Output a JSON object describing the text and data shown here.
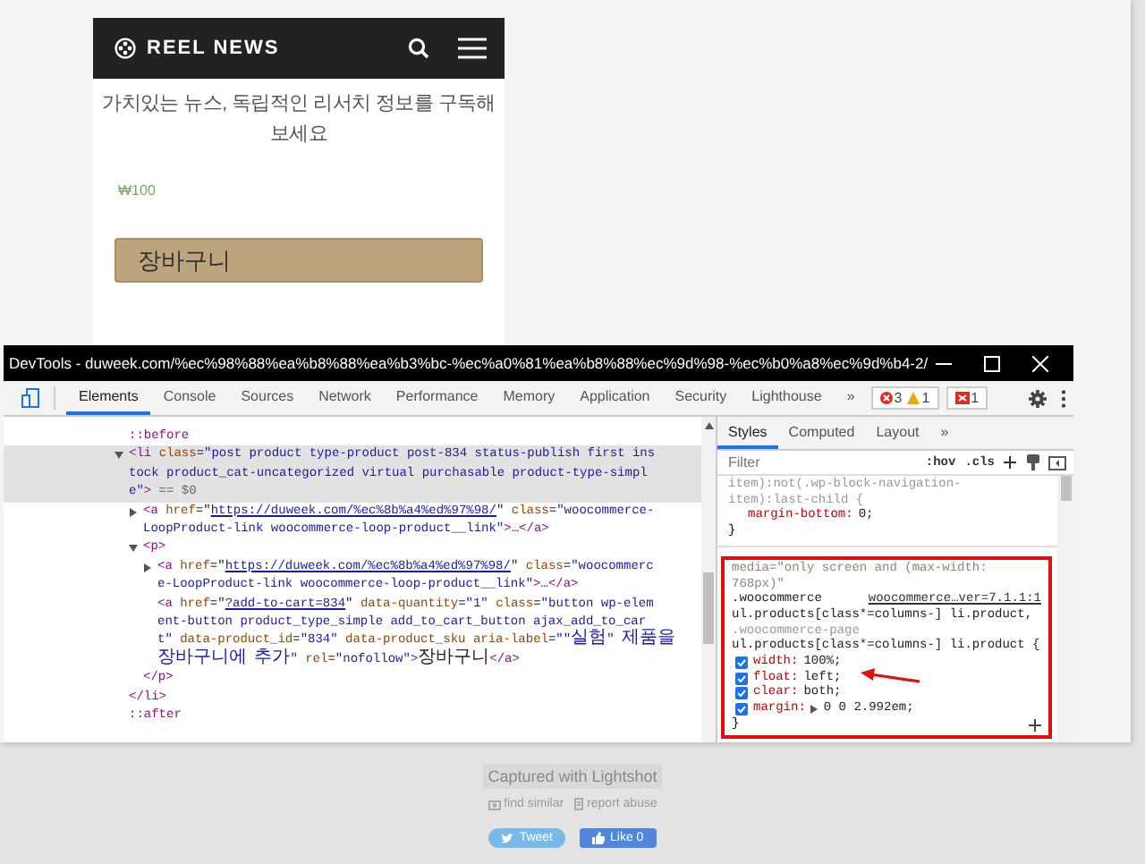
{
  "mobile_page": {
    "logo": "REEL NEWS",
    "description": "가치있는 뉴스, 독립적인 리서치 정보를 구독해 보세요",
    "price": "₩100",
    "cart_button": "장바구니"
  },
  "devtools": {
    "title": "DevTools - duweek.com/%ec%98%88%ea%b8%88%ea%b3%bc-%ec%a0%81%ea%b8%88%ec%9d%98-%ec%b0%a8%ec%9d%b4-2/",
    "tabs": [
      {
        "label": "Elements",
        "selected": true
      },
      {
        "label": "Console",
        "selected": false
      },
      {
        "label": "Sources",
        "selected": false
      },
      {
        "label": "Network",
        "selected": false
      },
      {
        "label": "Performance",
        "selected": false
      },
      {
        "label": "Memory",
        "selected": false
      },
      {
        "label": "Application",
        "selected": false
      },
      {
        "label": "Security",
        "selected": false
      },
      {
        "label": "Lighthouse",
        "selected": false
      }
    ],
    "more_tabs": "»",
    "issue_counts": {
      "errors": "3",
      "warnings": "1",
      "issues": "1"
    },
    "dom_nodes": [
      {
        "kind": "pseudo",
        "text": "::before",
        "selected": false
      },
      {
        "kind": "element",
        "selected": true,
        "expanded": true,
        "lines": [
          [
            {
              "kind": "tag",
              "text": "<li "
            },
            {
              "kind": "attr",
              "text": "class"
            },
            {
              "kind": "text",
              "text": "="
            },
            {
              "kind": "value",
              "text": "\"post product type-product post-834 status-publish first ins"
            }
          ],
          [
            {
              "kind": "value",
              "text": "tock product_cat-uncategorized virtual purchasable product-type-simpl"
            }
          ],
          [
            {
              "kind": "value",
              "text": "e\""
            },
            {
              "kind": "tag",
              "text": ">"
            },
            {
              "kind": "hint",
              "text": " == $0"
            }
          ]
        ],
        "closing": [
          {
            "kind": "tag",
            "text": "</li>"
          }
        ],
        "children": [
          {
            "kind": "element",
            "selected": false,
            "expanded": false,
            "lines": [
              [
                {
                  "kind": "tag",
                  "text": "<a "
                },
                {
                  "kind": "attr",
                  "text": "href"
                },
                {
                  "kind": "text",
                  "text": "=\""
                },
                {
                  "kind": "link",
                  "text": "https://duweek.com/%ec%8b%a4%ed%97%98/"
                },
                {
                  "kind": "text",
                  "text": "\" "
                },
                {
                  "kind": "attr",
                  "text": "class"
                },
                {
                  "kind": "text",
                  "text": "="
                },
                {
                  "kind": "value",
                  "text": "\"woocommerce-"
                }
              ],
              [
                {
                  "kind": "value",
                  "text": "LoopProduct-link woocommerce-loop-product__link\""
                },
                {
                  "kind": "tag",
                  "text": ">"
                },
                {
                  "kind": "text",
                  "text": "…"
                },
                {
                  "kind": "tag",
                  "text": "</a>"
                }
              ]
            ]
          },
          {
            "kind": "element",
            "selected": false,
            "expanded": true,
            "lines": [
              [
                {
                  "kind": "tag",
                  "text": "<p>"
                }
              ]
            ],
            "closing": [
              {
                "kind": "tag",
                "text": "</p>"
              }
            ],
            "children": [
              {
                "kind": "element",
                "selected": false,
                "expanded": false,
                "lines": [
                  [
                    {
                      "kind": "tag",
                      "text": "<a "
                    },
                    {
                      "kind": "attr",
                      "text": "href"
                    },
                    {
                      "kind": "text",
                      "text": "=\""
                    },
                    {
                      "kind": "link",
                      "text": "https://duweek.com/%ec%8b%a4%ed%97%98/"
                    },
                    {
                      "kind": "text",
                      "text": "\" "
                    },
                    {
                      "kind": "attr",
                      "text": "class"
                    },
                    {
                      "kind": "text",
                      "text": "="
                    },
                    {
                      "kind": "value",
                      "text": "\"woocommerc"
                    }
                  ],
                  [
                    {
                      "kind": "value",
                      "text": "e-LoopProduct-link woocommerce-loop-product__link\""
                    },
                    {
                      "kind": "tag",
                      "text": ">"
                    },
                    {
                      "kind": "text",
                      "text": "…"
                    },
                    {
                      "kind": "tag",
                      "text": "</a>"
                    }
                  ]
                ]
              },
              {
                "kind": "element",
                "selected": false,
                "lines": [
                  [
                    {
                      "kind": "tag",
                      "text": "<a "
                    },
                    {
                      "kind": "attr",
                      "text": "href"
                    },
                    {
                      "kind": "text",
                      "text": "=\""
                    },
                    {
                      "kind": "link",
                      "text": "?add-to-cart=834"
                    },
                    {
                      "kind": "text",
                      "text": "\" "
                    },
                    {
                      "kind": "attr",
                      "text": "data-quantity"
                    },
                    {
                      "kind": "text",
                      "text": "="
                    },
                    {
                      "kind": "value",
                      "text": "\"1\" "
                    },
                    {
                      "kind": "attr",
                      "text": "class"
                    },
                    {
                      "kind": "text",
                      "text": "="
                    },
                    {
                      "kind": "value",
                      "text": "\"button wp-elem"
                    }
                  ],
                  [
                    {
                      "kind": "value",
                      "text": "ent-button product_type_simple add_to_cart_button ajax_add_to_car"
                    }
                  ],
                  [
                    {
                      "kind": "value",
                      "text": "t\" "
                    },
                    {
                      "kind": "attr",
                      "text": "data-product_id"
                    },
                    {
                      "kind": "text",
                      "text": "="
                    },
                    {
                      "kind": "value",
                      "text": "\"834\" "
                    },
                    {
                      "kind": "attr",
                      "text": "data-product_sku aria-label"
                    },
                    {
                      "kind": "text",
                      "text": "="
                    },
                    {
                      "kind": "value",
                      "text": "\"\"실험\" 제품을"
                    }
                  ],
                  [
                    {
                      "kind": "value",
                      "text": "장바구니에 추가\" "
                    },
                    {
                      "kind": "attr",
                      "text": "rel"
                    },
                    {
                      "kind": "text",
                      "text": "="
                    },
                    {
                      "kind": "value",
                      "text": "\"nofollow\""
                    },
                    {
                      "kind": "tag",
                      "text": ">"
                    },
                    {
                      "kind": "text",
                      "text": "장바구니"
                    },
                    {
                      "kind": "tag",
                      "text": "</a>"
                    }
                  ]
                ]
              }
            ]
          }
        ]
      },
      {
        "kind": "pseudo",
        "text": "::after",
        "selected": false
      }
    ],
    "styles": {
      "tabs": [
        {
          "label": "Styles",
          "selected": true
        },
        {
          "label": "Computed",
          "selected": false
        },
        {
          "label": "Layout",
          "selected": false
        }
      ],
      "more_tabs": "»",
      "filter_placeholder": "Filter",
      "hov": ":hov",
      "cls": ".cls",
      "rules": [
        {
          "highlighted": false,
          "selector_lines": [
            {
              "text": "item):not(.wp-block-navigation-",
              "matched": false
            },
            {
              "text": "item):last-child {",
              "matched": false
            }
          ],
          "properties": [
            {
              "name": "margin-bottom:",
              "value": "0;"
            }
          ],
          "close": "}"
        },
        {
          "highlighted": true,
          "media": "media=\"only screen and (max-width: 768px)\"",
          "source": "woocommerce…ver=7.1.1:1",
          "selector_lines": [
            {
              "text": ".woocommerce",
              "matched": true
            },
            {
              "text": "ul.products[class*=columns-] li.product,",
              "matched": true
            },
            {
              "text": ".woocommerce-page",
              "matched": false
            },
            {
              "text": "ul.products[class*=columns-] li.product {",
              "matched": true
            }
          ],
          "properties": [
            {
              "name": "width:",
              "value": "100%;",
              "checked": true
            },
            {
              "name": "float:",
              "value": "left;",
              "checked": true
            },
            {
              "name": "clear:",
              "value": "both;",
              "checked": true
            },
            {
              "name": "margin:",
              "value": "0 0 2.992em;",
              "checked": true,
              "expandable": true
            }
          ],
          "close": "}"
        }
      ]
    }
  },
  "footer": {
    "caption": "Captured with Lightshot",
    "links": [
      "find similar",
      "report abuse"
    ],
    "tweet": "Tweet",
    "like": "Like 0"
  }
}
